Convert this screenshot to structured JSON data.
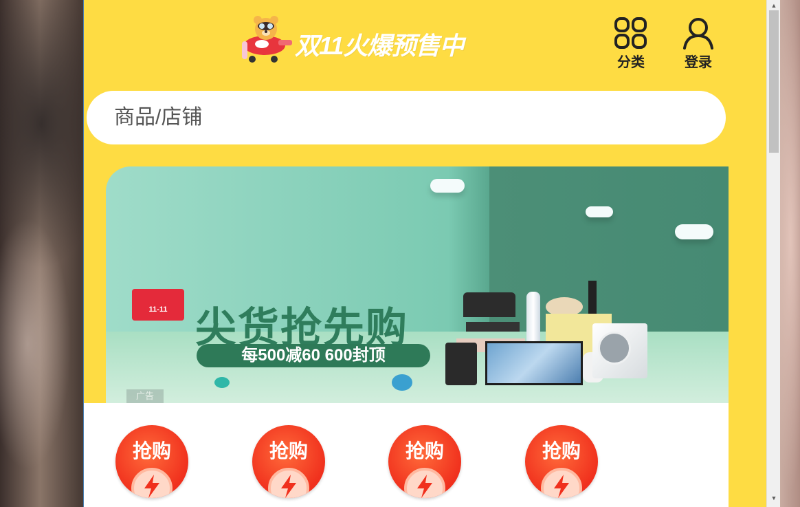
{
  "header": {
    "logo_text": "双11火爆预售中",
    "category_label": "分类",
    "login_label": "登录"
  },
  "search": {
    "placeholder": "商品/店铺"
  },
  "banner": {
    "badge_text": "11-11",
    "title": "尖货抢先购",
    "subtitle": "每500减60 600封顶",
    "ad_label": "广告"
  },
  "quick_links": [
    {
      "label": "抢购",
      "icon": "alarm-clock-bolt-icon"
    },
    {
      "label": "抢购",
      "icon": "alarm-clock-bolt-icon"
    },
    {
      "label": "抢购",
      "icon": "alarm-clock-bolt-icon"
    },
    {
      "label": "抢购",
      "icon": "alarm-clock-bolt-icon"
    }
  ],
  "colors": {
    "page_background": "#fedc43",
    "banner_title": "#2f7d5c",
    "quick_link_red": "#f0301d"
  }
}
